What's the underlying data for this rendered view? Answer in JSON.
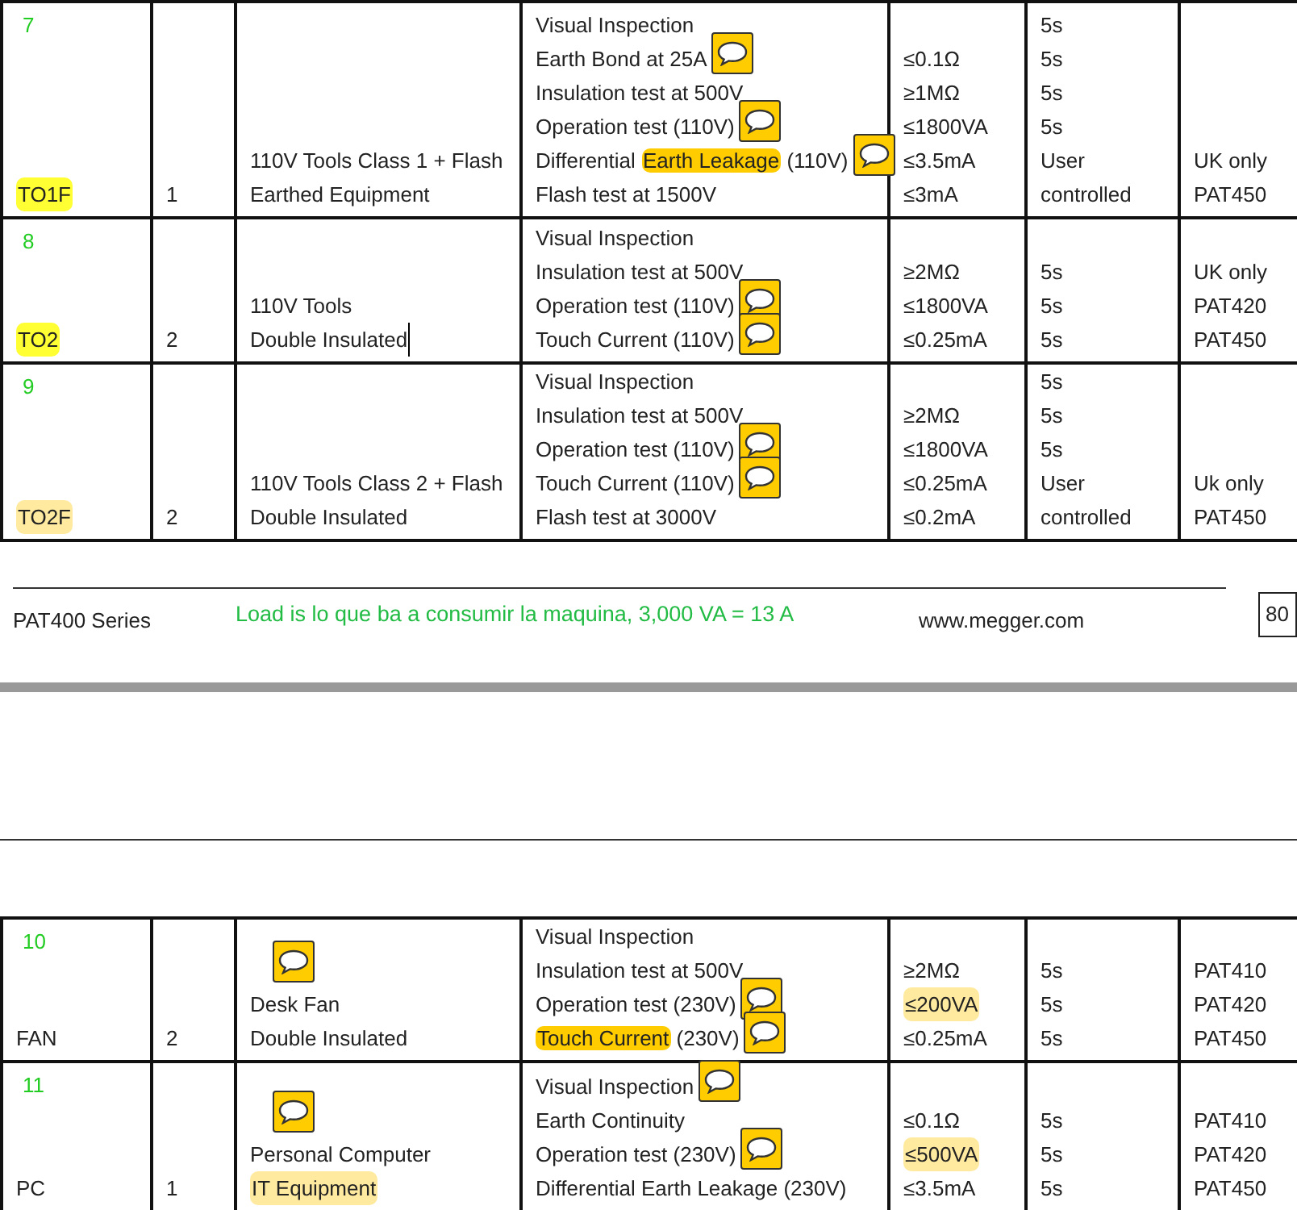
{
  "tables": [
    {
      "rows": [
        {
          "number": "7",
          "code": {
            "text": "TO1F",
            "highlighted": true,
            "kind": "bright"
          },
          "qty": "1",
          "description": [
            {
              "text": "110V Tools Class 1 + Flash"
            },
            {
              "text": "Earthed Equipment"
            }
          ],
          "tests": [
            {
              "text": "Visual Inspection"
            },
            {
              "text": "Earth Bond at 25A",
              "comment": true
            },
            {
              "text": "Insulation test at 500V"
            },
            {
              "text": "Operation test (110V)",
              "comment": true
            },
            {
              "parts": [
                {
                  "text": "Differential "
                },
                {
                  "text": "Earth Leakage",
                  "highlighted": true,
                  "kind": "amber"
                },
                {
                  "text": " (110V)"
                }
              ],
              "comment": true
            },
            {
              "text": "Flash test at 1500V"
            }
          ],
          "limits": [
            {
              "text": "≤0.1Ω"
            },
            {
              "text": "≥1MΩ"
            },
            {
              "text": "≤1800VA"
            },
            {
              "text": "≤3.5mA"
            },
            {
              "text": "≤3mA"
            }
          ],
          "times": [
            {
              "text": "5s"
            },
            {
              "text": "5s"
            },
            {
              "text": "5s"
            },
            {
              "text": "5s"
            },
            {
              "text": "User"
            },
            {
              "text": "controlled"
            }
          ],
          "models": [
            {
              "text": "UK only"
            },
            {
              "text": "PAT450"
            }
          ]
        },
        {
          "number": "8",
          "code": {
            "text": "TO2",
            "highlighted": true,
            "kind": "bright"
          },
          "qty": "2",
          "description": [
            {
              "text": "110V Tools"
            },
            {
              "text": "Double Insulated",
              "caret": true
            }
          ],
          "tests": [
            {
              "text": "Visual Inspection"
            },
            {
              "text": "Insulation test at 500V"
            },
            {
              "text": "Operation test (110V)",
              "comment": true
            },
            {
              "text": "Touch Current (110V)",
              "comment": true
            }
          ],
          "limits": [
            {
              "text": "≥2MΩ"
            },
            {
              "text": "≤1800VA"
            },
            {
              "text": "≤0.25mA"
            }
          ],
          "times": [
            {
              "text": "5s"
            },
            {
              "text": "5s"
            },
            {
              "text": "5s"
            }
          ],
          "models": [
            {
              "text": "UK only"
            },
            {
              "text": "PAT420"
            },
            {
              "text": "PAT450"
            }
          ]
        },
        {
          "number": "9",
          "code": {
            "text": "TO2F",
            "highlighted": true,
            "kind": "pale"
          },
          "qty": "2",
          "description": [
            {
              "text": "110V Tools Class 2 + Flash"
            },
            {
              "text": "Double Insulated"
            }
          ],
          "tests": [
            {
              "text": "Visual Inspection"
            },
            {
              "text": "Insulation test at 500V"
            },
            {
              "text": "Operation test (110V)",
              "comment": true
            },
            {
              "text": "Touch Current (110V)",
              "comment": true
            },
            {
              "text": "Flash test at 3000V"
            }
          ],
          "limits": [
            {
              "text": "≥2MΩ"
            },
            {
              "text": "≤1800VA"
            },
            {
              "text": "≤0.25mA"
            },
            {
              "text": "≤0.2mA"
            }
          ],
          "times": [
            {
              "text": "5s"
            },
            {
              "text": "5s"
            },
            {
              "text": "5s"
            },
            {
              "text": "User"
            },
            {
              "text": "controlled"
            }
          ],
          "models": [
            {
              "text": "Uk only"
            },
            {
              "text": "PAT450"
            }
          ]
        }
      ]
    },
    {
      "rows": [
        {
          "number": "10",
          "code": {
            "text": "FAN"
          },
          "qty": "2",
          "description_note": true,
          "description": [
            {
              "text": "Desk Fan"
            },
            {
              "text": "Double Insulated"
            }
          ],
          "tests": [
            {
              "text": "Visual Inspection"
            },
            {
              "text": "Insulation test at 500V"
            },
            {
              "text": "Operation test (230V)",
              "comment": true
            },
            {
              "parts": [
                {
                  "text": "Touch Current",
                  "highlighted": true,
                  "kind": "amber"
                },
                {
                  "text": " (230V)"
                }
              ],
              "comment": true
            }
          ],
          "limits": [
            {
              "text": "≥2MΩ"
            },
            {
              "text": "≤200VA",
              "highlighted": true,
              "kind": "pale"
            },
            {
              "text": "≤0.25mA"
            }
          ],
          "times": [
            {
              "text": "5s"
            },
            {
              "text": "5s"
            },
            {
              "text": "5s"
            }
          ],
          "models": [
            {
              "text": "PAT410"
            },
            {
              "text": "PAT420"
            },
            {
              "text": "PAT450"
            }
          ]
        },
        {
          "number": "11",
          "code": {
            "text": "PC"
          },
          "qty": "1",
          "description_note": true,
          "description": [
            {
              "text": "Personal Computer"
            },
            {
              "text": "IT Equipment",
              "highlighted": true,
              "kind": "pale"
            }
          ],
          "tests": [
            {
              "text": "Visual Inspection",
              "comment": true
            },
            {
              "text": "Earth Continuity"
            },
            {
              "text": "Operation test (230V)",
              "comment": true
            },
            {
              "text": "Differential Earth Leakage (230V)"
            }
          ],
          "limits": [
            {
              "text": "≤0.1Ω"
            },
            {
              "text": "≤500VA",
              "highlighted": true,
              "kind": "pale"
            },
            {
              "text": "≤3.5mA"
            }
          ],
          "times": [
            {
              "text": "5s"
            },
            {
              "text": "5s"
            },
            {
              "text": "5s"
            }
          ],
          "models": [
            {
              "text": "PAT410"
            },
            {
              "text": "PAT420"
            },
            {
              "text": "PAT450"
            }
          ]
        }
      ]
    }
  ],
  "footer": {
    "series": "PAT400 Series",
    "note": "Load is lo que ba a consumir la maquina, 3,000 VA = 13 A",
    "website": "www.megger.com",
    "page": "80"
  }
}
